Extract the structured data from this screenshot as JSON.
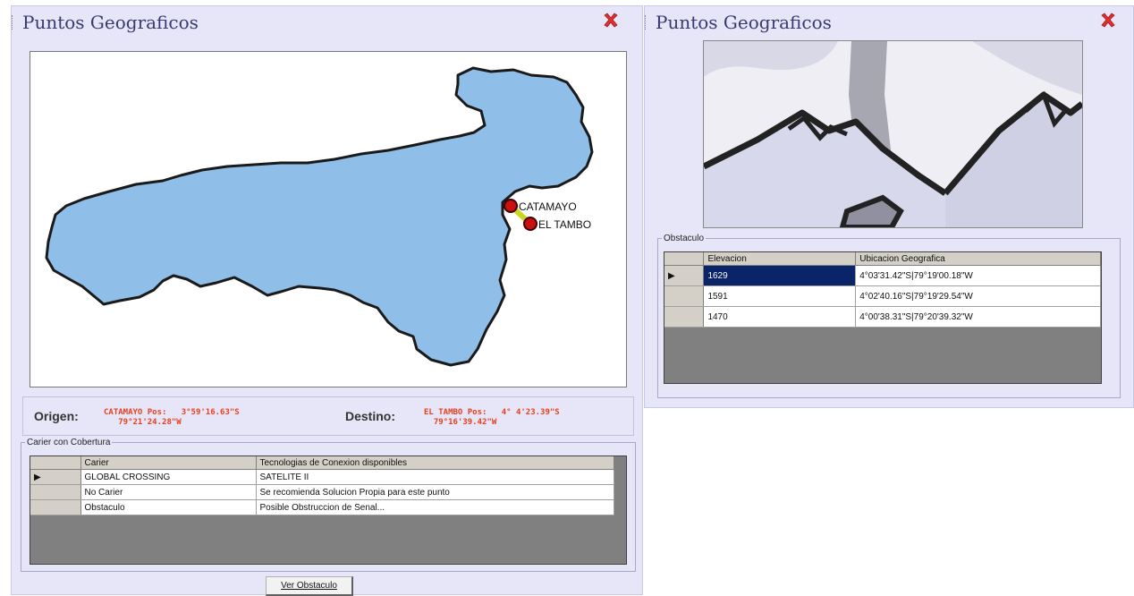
{
  "left_window": {
    "title": "Puntos Geograficos",
    "map": {
      "points": [
        {
          "name": "CATAMAYO"
        },
        {
          "name": "EL TAMBO"
        }
      ]
    },
    "route": {
      "origin_label": "Origen:",
      "origin_value": "CATAMAYO Pos:   3°59'16.63\"S\n   79°21'24.28\"W",
      "destination_label": "Destino:",
      "destination_value": "EL TAMBO Pos:   4° 4'23.39\"S\n  79°16'39.42\"W"
    },
    "carriers": {
      "legend": "Carier con Cobertura",
      "columns": [
        "Carier",
        "Tecnologias de Conexion disponibles"
      ],
      "rows": [
        {
          "carrier": "GLOBAL CROSSING",
          "tech": "SATELITE II",
          "current": true
        },
        {
          "carrier": "No Carier",
          "tech": "Se recomienda Solucion Propia para este punto",
          "current": false
        },
        {
          "carrier": "Obstaculo",
          "tech": "Posible Obstruccion de Senal...",
          "current": false
        }
      ]
    },
    "view_obstacle_button": "Ver Obstaculo"
  },
  "right_window": {
    "title": "Puntos Geograficos",
    "obstacle": {
      "legend": "Obstaculo",
      "columns": [
        "Elevacion",
        "Ubicacion Geografica"
      ],
      "rows": [
        {
          "elevation": "1629",
          "location": "4°03'31.42\"S|79°19'00.18\"W",
          "current": true
        },
        {
          "elevation": "1591",
          "location": "4°02'40.16\"S|79°19'29.54\"W",
          "current": false
        },
        {
          "elevation": "1470",
          "location": "4°00'38.31\"S|79°20'39.32\"W",
          "current": false
        }
      ]
    }
  },
  "colors": {
    "window_bg": "#e6e6f8",
    "map_fill": "#8fbfe8",
    "route_text": "#e8401c",
    "close_icon": "#e03030",
    "selection": "#0a246a"
  }
}
